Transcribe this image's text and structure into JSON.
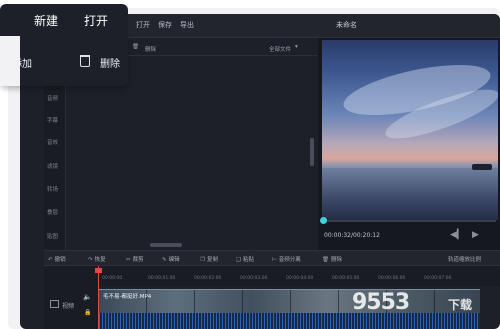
{
  "menu": {
    "open": "打开",
    "save": "保存",
    "export": "导出",
    "doc_title": "未命名"
  },
  "popup": {
    "new": "新建",
    "open": "打开",
    "add": "添加",
    "delete": "删除"
  },
  "side_tabs": [
    "音频",
    "字幕",
    "音效",
    "滤镜",
    "转场",
    "叠层",
    "贴图"
  ],
  "media": {
    "delete": "删除",
    "filter": "全部文件"
  },
  "preview": {
    "time": "00:00:32/00:20:12",
    "progress": 0.0
  },
  "timeline_toolbar": [
    "撤销",
    "恢复",
    "裁剪",
    "编辑",
    "复制",
    "粘贴",
    "音频分离",
    "删除"
  ],
  "timeline_right": "轨道缩放比例",
  "ruler_ticks": [
    "00:00:00",
    "00:00:01.00",
    "00:00:02.00",
    "00:00:03.00",
    "00:00:04.00",
    "00:00:05.00",
    "00:00:06.00",
    "00:00:07.00"
  ],
  "track": {
    "label": "视频",
    "clip_name": "毛不易-都挺好.MP4"
  },
  "watermark": {
    "main": "9553",
    "sub": "下载"
  }
}
